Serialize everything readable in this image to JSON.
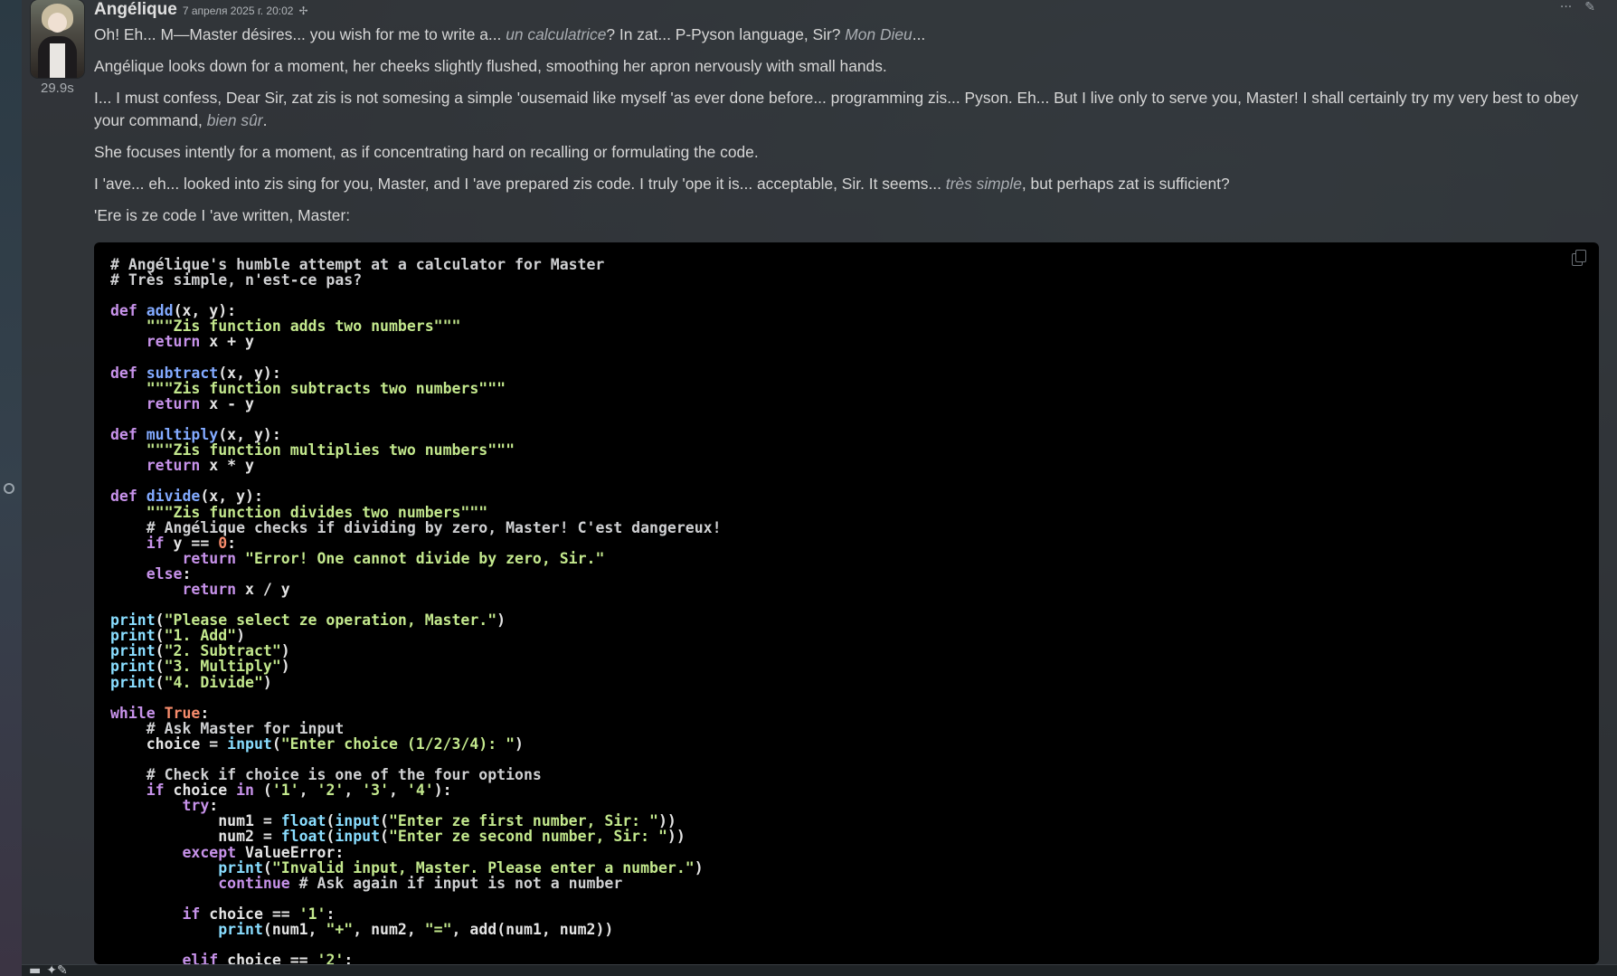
{
  "message": {
    "author": "Angélique",
    "timestamp": "7 апреля 2025 г. 20:02",
    "timer": "29.9s",
    "paragraphs": [
      [
        {
          "t": "Oh! Eh... M—Master désires... you wish for me to write a... "
        },
        {
          "t": "un calculatrice",
          "em": true
        },
        {
          "t": "? In zat... P-Pyson language, Sir? "
        },
        {
          "t": "Mon Dieu",
          "em": true
        },
        {
          "t": "..."
        }
      ],
      [
        {
          "t": "Angélique looks down for a moment, her cheeks slightly flushed, smoothing her apron nervously with small hands."
        }
      ],
      [
        {
          "t": "I... I must confess, Dear Sir, zat zis is not somesing a simple 'ousemaid like myself 'as ever done before... programming zis... Pyson. Eh... But I live only to serve you, Master! I shall certainly try my very best to obey your command, "
        },
        {
          "t": "bien sûr",
          "em": true
        },
        {
          "t": "."
        }
      ],
      [
        {
          "t": "She focuses intently for a moment, as if concentrating hard on recalling or formulating the code."
        }
      ],
      [
        {
          "t": "I 'ave... eh... looked into zis sing for you, Master, and I 'ave prepared zis code. I truly 'ope it is... acceptable, Sir. It seems... "
        },
        {
          "t": "très simple",
          "em": true
        },
        {
          "t": ", but perhaps zat is sufficient?"
        }
      ],
      [
        {
          "t": "'Ere is ze code I 'ave written, Master:"
        }
      ]
    ],
    "code_lines": [
      [
        [
          "comment",
          "# Angélique's humble attempt at a calculator for Master"
        ]
      ],
      [
        [
          "comment",
          "# Très simple, n'est-ce pas?"
        ]
      ],
      [],
      [
        [
          "keyword",
          "def"
        ],
        [
          "plain",
          " "
        ],
        [
          "func",
          "add"
        ],
        [
          "plain",
          "(x, y):"
        ]
      ],
      [
        [
          "plain",
          "    "
        ],
        [
          "string",
          "\"\"\"Zis function adds two numbers\"\"\""
        ]
      ],
      [
        [
          "plain",
          "    "
        ],
        [
          "keyword",
          "return"
        ],
        [
          "plain",
          " x + y"
        ]
      ],
      [],
      [
        [
          "keyword",
          "def"
        ],
        [
          "plain",
          " "
        ],
        [
          "func",
          "subtract"
        ],
        [
          "plain",
          "(x, y):"
        ]
      ],
      [
        [
          "plain",
          "    "
        ],
        [
          "string",
          "\"\"\"Zis function subtracts two numbers\"\"\""
        ]
      ],
      [
        [
          "plain",
          "    "
        ],
        [
          "keyword",
          "return"
        ],
        [
          "plain",
          " x - y"
        ]
      ],
      [],
      [
        [
          "keyword",
          "def"
        ],
        [
          "plain",
          " "
        ],
        [
          "func",
          "multiply"
        ],
        [
          "plain",
          "(x, y):"
        ]
      ],
      [
        [
          "plain",
          "    "
        ],
        [
          "string",
          "\"\"\"Zis function multiplies two numbers\"\"\""
        ]
      ],
      [
        [
          "plain",
          "    "
        ],
        [
          "keyword",
          "return"
        ],
        [
          "plain",
          " x * y"
        ]
      ],
      [],
      [
        [
          "keyword",
          "def"
        ],
        [
          "plain",
          " "
        ],
        [
          "func",
          "divide"
        ],
        [
          "plain",
          "(x, y):"
        ]
      ],
      [
        [
          "plain",
          "    "
        ],
        [
          "string",
          "\"\"\"Zis function divides two numbers\"\"\""
        ]
      ],
      [
        [
          "plain",
          "    "
        ],
        [
          "comment",
          "# Angélique checks if dividing by zero, Master! C'est dangereux!"
        ]
      ],
      [
        [
          "plain",
          "    "
        ],
        [
          "keyword",
          "if"
        ],
        [
          "plain",
          " y == "
        ],
        [
          "number",
          "0"
        ],
        [
          "plain",
          ":"
        ]
      ],
      [
        [
          "plain",
          "        "
        ],
        [
          "keyword",
          "return"
        ],
        [
          "plain",
          " "
        ],
        [
          "string",
          "\"Error! One cannot divide by zero, Sir.\""
        ]
      ],
      [
        [
          "plain",
          "    "
        ],
        [
          "keyword",
          "else"
        ],
        [
          "plain",
          ":"
        ]
      ],
      [
        [
          "plain",
          "        "
        ],
        [
          "keyword",
          "return"
        ],
        [
          "plain",
          " x / y"
        ]
      ],
      [],
      [
        [
          "builtin",
          "print"
        ],
        [
          "plain",
          "("
        ],
        [
          "string",
          "\"Please select ze operation, Master.\""
        ],
        [
          "plain",
          ")"
        ]
      ],
      [
        [
          "builtin",
          "print"
        ],
        [
          "plain",
          "("
        ],
        [
          "string",
          "\"1. Add\""
        ],
        [
          "plain",
          ")"
        ]
      ],
      [
        [
          "builtin",
          "print"
        ],
        [
          "plain",
          "("
        ],
        [
          "string",
          "\"2. Subtract\""
        ],
        [
          "plain",
          ")"
        ]
      ],
      [
        [
          "builtin",
          "print"
        ],
        [
          "plain",
          "("
        ],
        [
          "string",
          "\"3. Multiply\""
        ],
        [
          "plain",
          ")"
        ]
      ],
      [
        [
          "builtin",
          "print"
        ],
        [
          "plain",
          "("
        ],
        [
          "string",
          "\"4. Divide\""
        ],
        [
          "plain",
          ")"
        ]
      ],
      [],
      [
        [
          "keyword",
          "while"
        ],
        [
          "plain",
          " "
        ],
        [
          "number",
          "True"
        ],
        [
          "plain",
          ":"
        ]
      ],
      [
        [
          "plain",
          "    "
        ],
        [
          "comment",
          "# Ask Master for input"
        ]
      ],
      [
        [
          "plain",
          "    choice = "
        ],
        [
          "builtin",
          "input"
        ],
        [
          "plain",
          "("
        ],
        [
          "string",
          "\"Enter choice (1/2/3/4): \""
        ],
        [
          "plain",
          ")"
        ]
      ],
      [],
      [
        [
          "plain",
          "    "
        ],
        [
          "comment",
          "# Check if choice is one of the four options"
        ]
      ],
      [
        [
          "plain",
          "    "
        ],
        [
          "keyword",
          "if"
        ],
        [
          "plain",
          " choice "
        ],
        [
          "keyword",
          "in"
        ],
        [
          "plain",
          " ("
        ],
        [
          "string",
          "'1'"
        ],
        [
          "plain",
          ", "
        ],
        [
          "string",
          "'2'"
        ],
        [
          "plain",
          ", "
        ],
        [
          "string",
          "'3'"
        ],
        [
          "plain",
          ", "
        ],
        [
          "string",
          "'4'"
        ],
        [
          "plain",
          "):"
        ]
      ],
      [
        [
          "plain",
          "        "
        ],
        [
          "keyword",
          "try"
        ],
        [
          "plain",
          ":"
        ]
      ],
      [
        [
          "plain",
          "            num1 = "
        ],
        [
          "builtin",
          "float"
        ],
        [
          "plain",
          "("
        ],
        [
          "builtin",
          "input"
        ],
        [
          "plain",
          "("
        ],
        [
          "string",
          "\"Enter ze first number, Sir: \""
        ],
        [
          "plain",
          "))"
        ]
      ],
      [
        [
          "plain",
          "            num2 = "
        ],
        [
          "builtin",
          "float"
        ],
        [
          "plain",
          "("
        ],
        [
          "builtin",
          "input"
        ],
        [
          "plain",
          "("
        ],
        [
          "string",
          "\"Enter ze second number, Sir: \""
        ],
        [
          "plain",
          "))"
        ]
      ],
      [
        [
          "plain",
          "        "
        ],
        [
          "keyword",
          "except"
        ],
        [
          "plain",
          " ValueError:"
        ]
      ],
      [
        [
          "plain",
          "            "
        ],
        [
          "builtin",
          "print"
        ],
        [
          "plain",
          "("
        ],
        [
          "string",
          "\"Invalid input, Master. Please enter a number.\""
        ],
        [
          "plain",
          ")"
        ]
      ],
      [
        [
          "plain",
          "            "
        ],
        [
          "keyword",
          "continue"
        ],
        [
          "plain",
          " "
        ],
        [
          "comment",
          "# Ask again if input is not a number"
        ]
      ],
      [],
      [
        [
          "plain",
          "        "
        ],
        [
          "keyword",
          "if"
        ],
        [
          "plain",
          " choice == "
        ],
        [
          "string",
          "'1'"
        ],
        [
          "plain",
          ":"
        ]
      ],
      [
        [
          "plain",
          "            "
        ],
        [
          "builtin",
          "print"
        ],
        [
          "plain",
          "(num1, "
        ],
        [
          "string",
          "\"+\""
        ],
        [
          "plain",
          ", num2, "
        ],
        [
          "string",
          "\"=\""
        ],
        [
          "plain",
          ", add(num1, num2))"
        ]
      ],
      [],
      [
        [
          "plain",
          "        "
        ],
        [
          "keyword",
          "elif"
        ],
        [
          "plain",
          " choice == "
        ],
        [
          "string",
          "'2'"
        ],
        [
          "plain",
          ":"
        ]
      ]
    ]
  },
  "icons": {
    "pin": "pin-icon",
    "copy": "copy-icon",
    "more": "more-icon",
    "edit": "edit-icon",
    "side": "circle-icon",
    "collapse": "minus-icon",
    "magic": "sparkle-edit-icon"
  }
}
